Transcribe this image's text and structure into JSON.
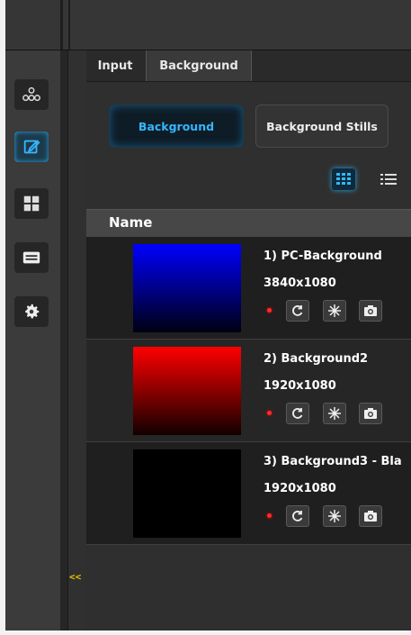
{
  "tabs": [
    {
      "label": "Input"
    },
    {
      "label": "Background"
    }
  ],
  "segments": {
    "background": "Background",
    "stills": "Background Stills"
  },
  "list_header": "Name",
  "sidebar_icons": [
    "network-icon",
    "edit-icon",
    "layout-grid-icon",
    "keyboard-icon",
    "gear-icon"
  ],
  "collapse_label": "<<",
  "backgrounds": [
    {
      "title": "1) PC-Background",
      "resolution": "3840x1080",
      "thumb_colors": [
        "#0000ff",
        "#000010"
      ]
    },
    {
      "title": "2) Background2",
      "resolution": "1920x1080",
      "thumb_colors": [
        "#ff0000",
        "#100000"
      ]
    },
    {
      "title": "3) Background3 - Bla",
      "resolution": "1920x1080",
      "thumb_colors": [
        "#000000",
        "#000000"
      ]
    }
  ],
  "colors": {
    "accent": "#35b6ff",
    "status_dot": "#ff2a2a"
  }
}
